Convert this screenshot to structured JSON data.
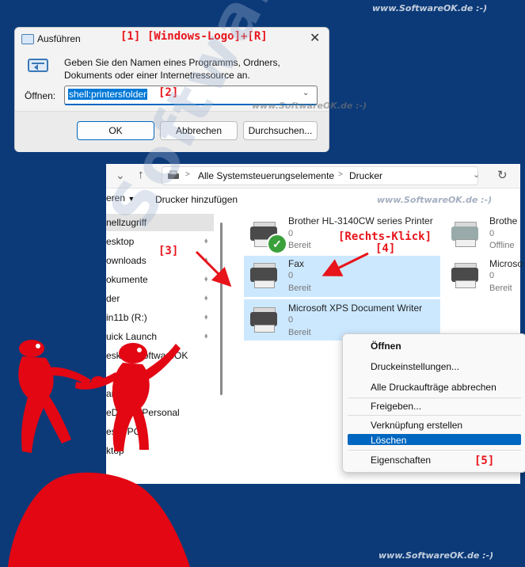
{
  "watermarks": {
    "top": "www.SoftwareOK.de :-)",
    "middle": "www.SoftwareOK.de :-)",
    "explorer": "www.SoftwareOK.de :-)",
    "bottom": "www.SoftwareOK.de :-)",
    "big": "SoftwareOK.de"
  },
  "annotations": {
    "a1": "[1]",
    "a1_keys": "[Windows-Logo]+[R]",
    "a2": "[2]",
    "a3": "[3]",
    "a4_label": "[Rechts-Klick]",
    "a4": "[4]",
    "a5": "[5]"
  },
  "run_dialog": {
    "title": "Ausführen",
    "description_line1": "Geben Sie den Namen eines Programms, Ordners,",
    "description_line2": "Dokuments oder einer Internetressource an.",
    "open_label": "Öffnen:",
    "open_value": "shell:printersfolder",
    "ok": "OK",
    "cancel": "Abbrechen",
    "browse": "Durchsuchen..."
  },
  "explorer": {
    "breadcrumb_root": "Alle Systemsteuerungselemente",
    "breadcrumb_sep": ">",
    "breadcrumb_current": "Drucker",
    "toolbar_more": "eren",
    "toolbar_add": "Drucker hinzufügen",
    "sidebar": [
      {
        "label": "nellzugriff",
        "pinned": false
      },
      {
        "label": "esktop",
        "pinned": true
      },
      {
        "label": "ownloads",
        "pinned": true
      },
      {
        "label": "okumente",
        "pinned": true
      },
      {
        "label": "der",
        "pinned": true
      },
      {
        "label": "in11b (R:)",
        "pinned": true
      },
      {
        "label": "uick Launch",
        "pinned": true
      },
      {
        "label": "esktop.SoftwareOK",
        "pinned": false
      },
      {
        "label": "",
        "pinned": false
      },
      {
        "label": "anScan",
        "pinned": false
      },
      {
        "label": "eDrive - Personal",
        "pinned": false
      },
      {
        "label": "eser PC",
        "pinned": false
      },
      {
        "label": "ktop",
        "pinned": false
      }
    ],
    "printers": [
      {
        "name": "Brother HL-3140CW series Printer",
        "count": "0",
        "status": "Bereit"
      },
      {
        "name": "Fax",
        "count": "0",
        "status": "Bereit"
      },
      {
        "name": "Microsoft XPS Document Writer",
        "count": "0",
        "status": "Bereit"
      }
    ],
    "printers_right": [
      {
        "name": "Brothe",
        "count": "0",
        "status": "Offline"
      },
      {
        "name": "Microso",
        "count": "0",
        "status": "Bereit"
      }
    ]
  },
  "context_menu": {
    "open": "Öffnen",
    "print_settings": "Druckeinstellungen...",
    "cancel_all": "Alle Druckaufträge abbrechen",
    "share": "Freigeben...",
    "create_shortcut": "Verknüpfung erstellen",
    "delete": "Löschen",
    "properties": "Eigenschaften"
  },
  "colors": {
    "background": "#0c3a78",
    "annotation_red": "#e8141b",
    "selection_blue": "#cce8ff",
    "menu_highlight": "#0067c0"
  }
}
